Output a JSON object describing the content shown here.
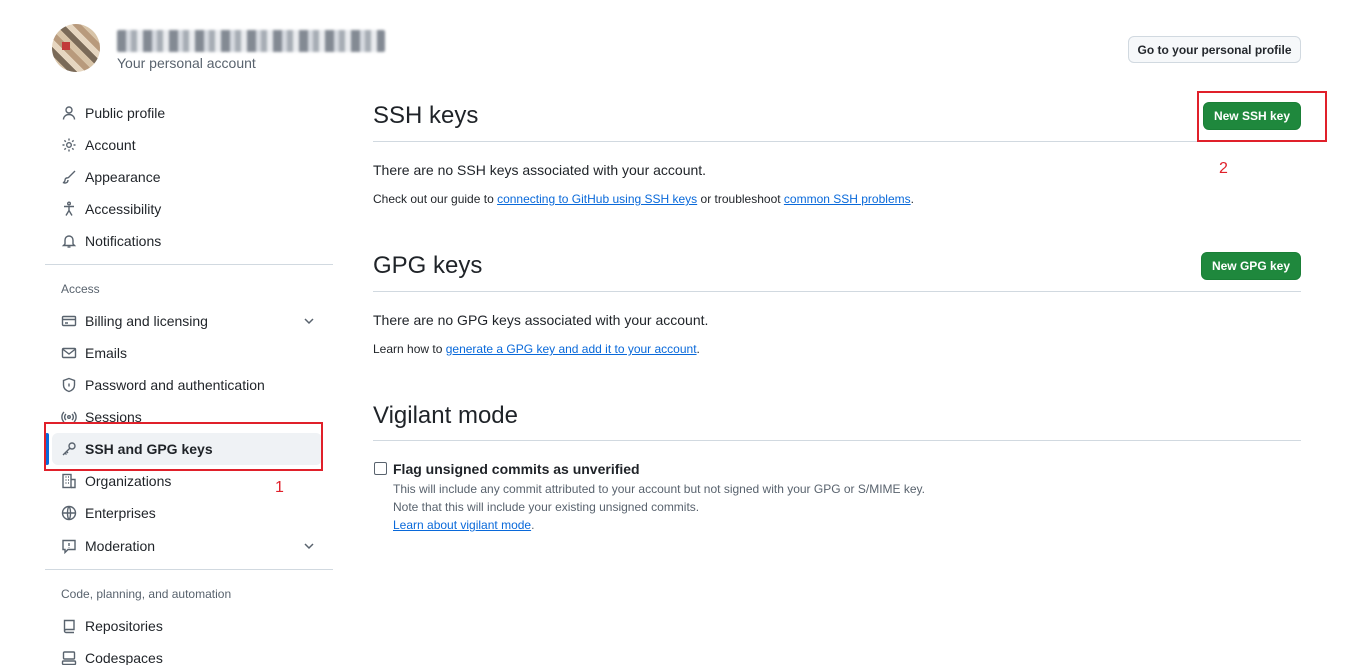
{
  "header": {
    "user_name": "",
    "subtitle": "Your personal account",
    "profile_button": "Go to your personal profile"
  },
  "sidebar": {
    "items_top": [
      {
        "label": "Public profile",
        "icon": "person-icon"
      },
      {
        "label": "Account",
        "icon": "gear-icon"
      },
      {
        "label": "Appearance",
        "icon": "paintbrush-icon"
      },
      {
        "label": "Accessibility",
        "icon": "accessibility-icon"
      },
      {
        "label": "Notifications",
        "icon": "bell-icon"
      }
    ],
    "access_heading": "Access",
    "items_access": [
      {
        "label": "Billing and licensing",
        "icon": "credit-card-icon"
      },
      {
        "label": "Emails",
        "icon": "mail-icon"
      },
      {
        "label": "Password and authentication",
        "icon": "shield-lock-icon"
      },
      {
        "label": "Sessions",
        "icon": "broadcast-icon"
      },
      {
        "label": "SSH and GPG keys",
        "icon": "key-icon",
        "active": true
      },
      {
        "label": "Organizations",
        "icon": "organization-icon"
      },
      {
        "label": "Enterprises",
        "icon": "globe-icon"
      },
      {
        "label": "Moderation",
        "icon": "report-icon"
      }
    ],
    "code_heading": "Code, planning, and automation",
    "items_code": [
      {
        "label": "Repositories",
        "icon": "repo-icon"
      },
      {
        "label": "Codespaces",
        "icon": "codespaces-icon"
      }
    ]
  },
  "ssh": {
    "title": "SSH keys",
    "button": "New SSH key",
    "empty": "There are no SSH keys associated with your account.",
    "guide_prefix": "Check out our guide to ",
    "guide_link": "connecting to GitHub using SSH keys",
    "guide_mid": " or troubleshoot ",
    "guide_link2": "common SSH problems",
    "guide_suffix": "."
  },
  "gpg": {
    "title": "GPG keys",
    "button": "New GPG key",
    "empty": "There are no GPG keys associated with your account.",
    "learn_prefix": "Learn how to ",
    "learn_link": "generate a GPG key and add it to your account",
    "learn_suffix": "."
  },
  "vigilant": {
    "title": "Vigilant mode",
    "checkbox_label": "Flag unsigned commits as unverified",
    "note1": "This will include any commit attributed to your account but not signed with your GPG or S/MIME key.",
    "note2": "Note that this will include your existing unsigned commits.",
    "note_link": "Learn about vigilant mode",
    "note_suffix": "."
  },
  "annotations": {
    "marker1": "1",
    "marker2": "2"
  },
  "colors": {
    "accent": "#0969da",
    "green_button": "#1f883d",
    "annotation_red": "#e0202a"
  }
}
